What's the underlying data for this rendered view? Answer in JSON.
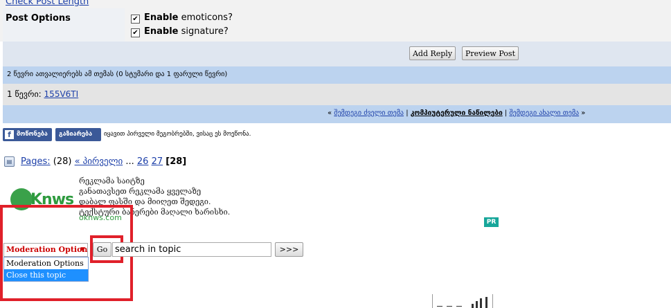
{
  "top": {
    "check_post_length": "Check Post Length"
  },
  "post_options": {
    "label": "Post Options",
    "options": [
      {
        "bold": "Enable",
        "rest": " emoticons?",
        "checked": true
      },
      {
        "bold": "Enable",
        "rest": " signature?",
        "checked": true
      }
    ]
  },
  "buttons": {
    "add_reply": "Add Reply",
    "preview_post": "Preview Post"
  },
  "readers": {
    "text": "2 წევრი ათვალიერებს ამ თემას (0 სტუმარი და 1 ფარული წევრი)"
  },
  "members": {
    "label": "1 წევრი:",
    "member": "155V6TI"
  },
  "nav": {
    "open": "« ",
    "prev": "შემდეგი ძველი თემა",
    "sep1": " | ",
    "current": "კომპიუტერული ნაწილები",
    "sep2": " | ",
    "next": "შემდეგი ახალი თემა",
    "close": " »"
  },
  "facebook": {
    "like_icon": "f",
    "like": "მოწონება",
    "share": "გაზიარება",
    "text": "იყავით პირველი მეგობრებში, ვისაც ეს მოეწონა."
  },
  "pages": {
    "icon": "pages-icon",
    "label": "Pages:",
    "count": "(28)",
    "first": "« პირველი",
    "ellipsis": "...",
    "p26": "26",
    "p27": "27",
    "current": "[28]"
  },
  "ad": {
    "logo_text": "Knws",
    "lines": [
      "რეკლამა საიტზე",
      "განათავსეთ რეკლამა ყველაზე",
      "დაბალ ფასში და მიიღეთ შედეგი.",
      "ტექსტური ბანერები მაღალი ხარისხი."
    ],
    "url": "oknws.com",
    "badge": "PR"
  },
  "moderation": {
    "selected": "Moderation Option",
    "arrow": "▼",
    "options": [
      "Moderation Options",
      "Close this topic"
    ],
    "go": "Go"
  },
  "search": {
    "value": "search in topic",
    "go": ">>>"
  },
  "colors": {
    "accent_red": "#e0202a",
    "link": "#1b3ea8",
    "facebook": "#3b5998",
    "highlight": "#1e90ff"
  }
}
